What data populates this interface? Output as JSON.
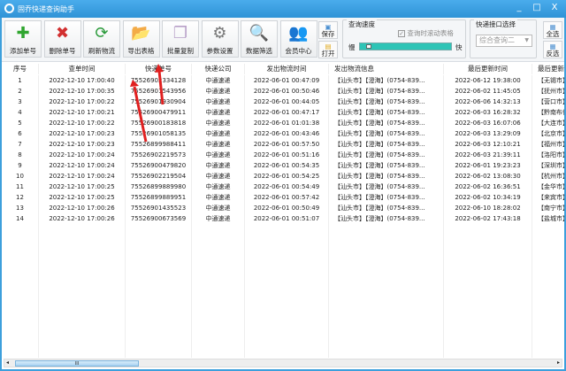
{
  "window": {
    "title": "固乔快递查询助手",
    "minimize": "_",
    "maximize": "□",
    "close": "X"
  },
  "toolbar": {
    "buttons": [
      {
        "label": "添加单号",
        "icon": "plus-icon",
        "glyph": "✚",
        "color": "#2fa52f"
      },
      {
        "label": "删除单号",
        "icon": "delete-x-icon",
        "glyph": "✖",
        "color": "#d23030"
      },
      {
        "label": "刷新物流",
        "icon": "refresh-icon",
        "glyph": "⟳",
        "color": "#2a9a3a"
      },
      {
        "label": "导出表格",
        "icon": "folder-export-icon",
        "glyph": "📂",
        "color": "#e0a818"
      },
      {
        "label": "批量复制",
        "icon": "copy-icon",
        "glyph": "❐",
        "color": "#b8a0c8"
      },
      {
        "label": "参数设置",
        "icon": "gear-icon",
        "glyph": "⚙",
        "color": "#777"
      },
      {
        "label": "数据筛选",
        "icon": "magnifier-folder-icon",
        "glyph": "🔍",
        "color": "#e0a818"
      },
      {
        "label": "会员中心",
        "icon": "users-icon",
        "glyph": "👥",
        "color": "#c04040"
      }
    ],
    "save": "保存",
    "open": "打开",
    "speed": {
      "title": "查询速度",
      "checkbox": "查询时滚动表格",
      "checked": true,
      "slow": "慢",
      "fast": "快",
      "value": 0.05
    },
    "api": {
      "title": "快递接口选择",
      "selected": "综合查询二"
    },
    "select_all": "全选",
    "invert": "反选"
  },
  "table": {
    "columns": [
      "序号",
      "查单时间",
      "快递单号",
      "快递公司",
      "发出物流时间",
      "发出物流信息",
      "最后更新时间",
      "最后更新物"
    ],
    "rows": [
      [
        "1",
        "2022-12-10 17:00:40",
        "75526902334128",
        "中通速递",
        "2022-06-01 00:47:09",
        "【汕头市】【澄海】(0754-839...",
        "2022-06-12 19:38:00",
        "【无锡市】"
      ],
      [
        "2",
        "2022-12-10 17:00:35",
        "75526901543956",
        "中通速递",
        "2022-06-01 00:50:46",
        "【汕头市】【澄海】(0754-839...",
        "2022-06-02 11:45:05",
        "【抚州市】"
      ],
      [
        "3",
        "2022-12-10 17:00:22",
        "75526901930904",
        "中通速递",
        "2022-06-01 00:44:05",
        "【汕头市】【澄海】(0754-839...",
        "2022-06-06 14:32:13",
        "【营口市】"
      ],
      [
        "4",
        "2022-12-10 17:00:21",
        "75526900479911",
        "中通速递",
        "2022-06-01 00:47:17",
        "【汕头市】【澄海】(0754-839...",
        "2022-06-03 16:28:32",
        "【黔南布依"
      ],
      [
        "5",
        "2022-12-10 17:00:22",
        "75526900183818",
        "中通速递",
        "2022-06-01 01:01:38",
        "【汕头市】【澄海】(0754-839...",
        "2022-06-03 16:07:06",
        "【大连市】"
      ],
      [
        "6",
        "2022-12-10 17:00:23",
        "75526901058135",
        "中通速递",
        "2022-06-01 00:43:46",
        "【汕头市】【澄海】(0754-839...",
        "2022-06-03 13:29:09",
        "【北京市】"
      ],
      [
        "7",
        "2022-12-10 17:00:23",
        "75526899988411",
        "中通速递",
        "2022-06-01 00:57:50",
        "【汕头市】【澄海】(0754-839...",
        "2022-06-03 12:10:21",
        "【福州市】"
      ],
      [
        "8",
        "2022-12-10 17:00:24",
        "75526902219573",
        "中通速递",
        "2022-06-01 00:51:16",
        "【汕头市】【澄海】(0754-839...",
        "2022-06-03 21:39:11",
        "【洛阳市】"
      ],
      [
        "9",
        "2022-12-10 17:00:24",
        "75526900479820",
        "中通速递",
        "2022-06-01 00:54:35",
        "【汕头市】【澄海】(0754-839...",
        "2022-06-01 19:23:23",
        "【深圳市】"
      ],
      [
        "10",
        "2022-12-10 17:00:24",
        "75526902219504",
        "中通速递",
        "2022-06-01 00:54:25",
        "【汕头市】【澄海】(0754-839...",
        "2022-06-02 13:08:30",
        "【杭州市】"
      ],
      [
        "11",
        "2022-12-10 17:00:25",
        "75526899889980",
        "中通速递",
        "2022-06-01 00:54:49",
        "【汕头市】【澄海】(0754-839...",
        "2022-06-02 16:36:51",
        "【金华市】"
      ],
      [
        "12",
        "2022-12-10 17:00:25",
        "75526899889951",
        "中通速递",
        "2022-06-01 00:57:42",
        "【汕头市】【澄海】(0754-839...",
        "2022-06-02 10:34:19",
        "【来宾市】"
      ],
      [
        "13",
        "2022-12-10 17:00:26",
        "75526901435523",
        "中通速递",
        "2022-06-01 00:50:49",
        "【汕头市】【澄海】(0754-839...",
        "2022-06-10 18:28:02",
        "【南宁市】"
      ],
      [
        "14",
        "2022-12-10 17:00:26",
        "75526900673569",
        "中通速递",
        "2022-06-01 00:51:07",
        "【汕头市】【澄海】(0754-839...",
        "2022-06-02 17:43:18",
        "【盐城市】"
      ]
    ]
  },
  "scrollbar": {
    "grip": "III"
  },
  "colors": {
    "titlebar": "#3d9fdc",
    "progress": "#2ec4b6",
    "arrow": "#e02020"
  }
}
